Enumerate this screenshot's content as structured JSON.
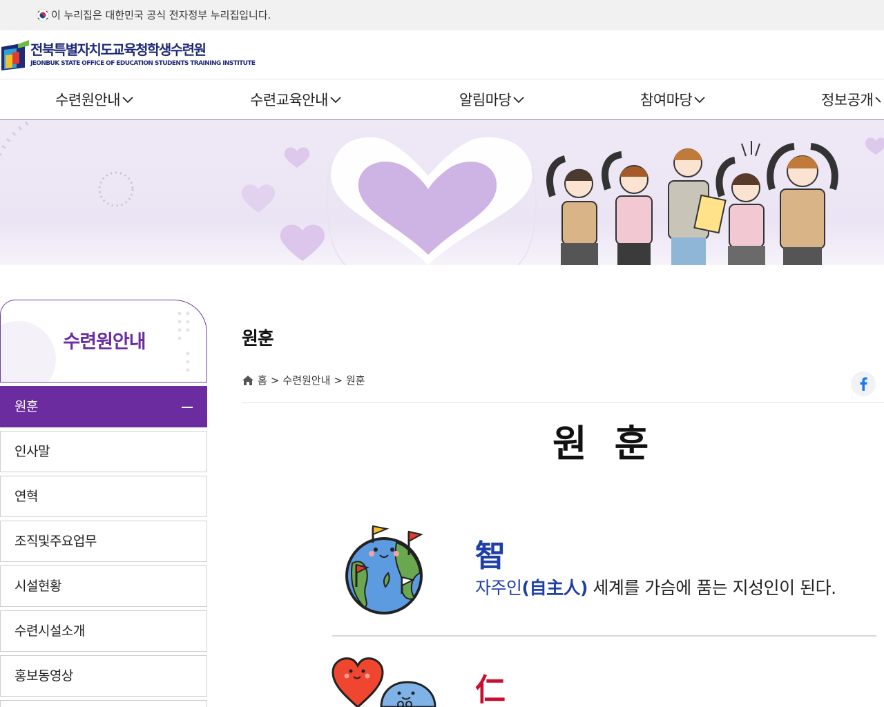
{
  "gov_banner": {
    "text": "이 누리집은 대한민국 공식 전자정부 누리집입니다."
  },
  "header": {
    "logo_ko": "전북특별자치도교육청학생수련원",
    "logo_en": "JEONBUK STATE OFFICE OF EDUCATION STUDENTS TRAINING INSTITUTE"
  },
  "gnb": {
    "items": [
      {
        "label": "수련원안내"
      },
      {
        "label": "수련교육안내"
      },
      {
        "label": "알림마당"
      },
      {
        "label": "참여마당"
      },
      {
        "label": "정보공개"
      }
    ]
  },
  "sidebar": {
    "title": "수련원안내",
    "items": [
      {
        "label": "원훈",
        "active": true
      },
      {
        "label": "인사말"
      },
      {
        "label": "연혁"
      },
      {
        "label": "조직및주요업무"
      },
      {
        "label": "시설현황"
      },
      {
        "label": "수련시설소개"
      },
      {
        "label": "홍보동영상"
      }
    ]
  },
  "content": {
    "page_title": "원훈",
    "breadcrumb": {
      "home": "홈",
      "sep": ">",
      "level1": "수련원안내",
      "level2": "원훈"
    },
    "share_icon": "facebook-icon",
    "motto_title": "원훈",
    "virtues": [
      {
        "char": "智",
        "char_color": "#1f3fa8",
        "desc_a": "자주인",
        "desc_hanja": "(自主人)",
        "desc_b": " 세계를 가슴에 품는 지성인이 된다."
      },
      {
        "char": "仁",
        "char_color": "#c8102e"
      }
    ]
  },
  "colors": {
    "primary": "#6a2c9e",
    "navy": "#1e2a78",
    "blue": "#1f3fa8",
    "red": "#c8102e"
  }
}
